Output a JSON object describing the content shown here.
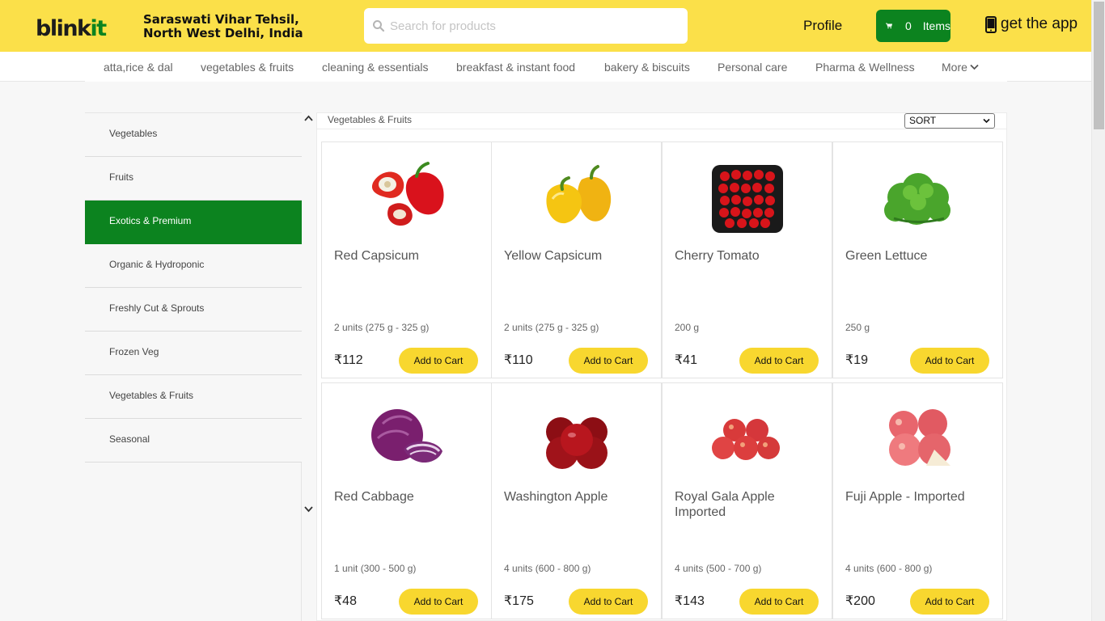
{
  "header": {
    "logo_left": "blink",
    "logo_right": "it",
    "location_line1": "Saraswati Vihar Tehsil,",
    "location_line2": "North West Delhi, India",
    "search_placeholder": "Search for products",
    "profile": "Profile",
    "cart_count": "0",
    "cart_label": "Items",
    "get_app": "get the app",
    "colors": {
      "header_bg": "#fbe049",
      "brand_green": "#0c831f"
    }
  },
  "nav": {
    "items": [
      "atta,rice & dal",
      "vegetables & fruits",
      "cleaning & essentials",
      "breakfast & instant food",
      "bakery & biscuits",
      "Personal care",
      "Pharma & Wellness"
    ],
    "more": "More"
  },
  "sidebar": {
    "categories": [
      "Vegetables",
      "Fruits",
      "Exotics & Premium",
      "Organic & Hydroponic",
      "Freshly Cut & Sprouts",
      "Frozen Veg",
      "Vegetables & Fruits",
      "Seasonal"
    ],
    "active_index": 2
  },
  "main": {
    "breadcrumb": "Vegetables & Fruits",
    "sort_label": "SORT",
    "add_label": "Add to Cart",
    "products": [
      {
        "name": "Red Capsicum",
        "qty": "2 units (275 g - 325 g)",
        "price": "₹112",
        "image": "red-capsicum"
      },
      {
        "name": "Yellow Capsicum",
        "qty": "2 units (275 g - 325 g)",
        "price": "₹110",
        "image": "yellow-capsicum"
      },
      {
        "name": "Cherry Tomato",
        "qty": "200 g",
        "price": "₹41",
        "image": "cherry-tomato"
      },
      {
        "name": "Green Lettuce",
        "qty": "250 g",
        "price": "₹19",
        "image": "green-lettuce"
      },
      {
        "name": "Red Cabbage",
        "qty": "1 unit (300 - 500 g)",
        "price": "₹48",
        "image": "red-cabbage"
      },
      {
        "name": "Washington Apple",
        "qty": "4 units (600 - 800 g)",
        "price": "₹175",
        "image": "washington-apple"
      },
      {
        "name": "Royal Gala Apple Imported",
        "qty": "4 units (500 - 700 g)",
        "price": "₹143",
        "image": "royal-gala-apple"
      },
      {
        "name": "Fuji Apple - Imported",
        "qty": "4 units (600 - 800 g)",
        "price": "₹200",
        "image": "fuji-apple"
      }
    ]
  }
}
